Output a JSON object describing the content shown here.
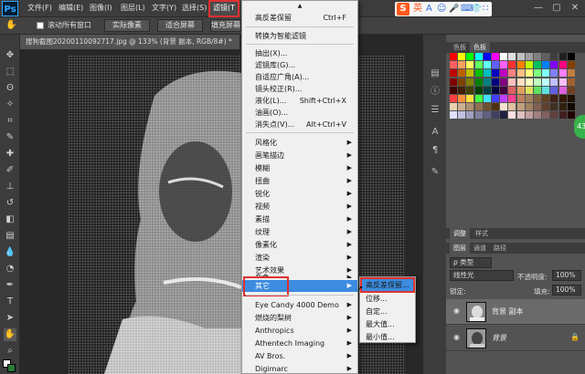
{
  "app": {
    "logo": "Ps"
  },
  "menubar": {
    "items": [
      "文件(F)",
      "编辑(E)",
      "图像(I)",
      "图层(L)",
      "文字(Y)",
      "选择(S)"
    ],
    "active": "滤镜(T"
  },
  "ime_toolbar": {
    "logo": "S",
    "items": [
      "英",
      "A",
      "☺",
      "🎤",
      "⌨",
      "👕",
      "∷"
    ]
  },
  "window_controls": [
    "—",
    "▢",
    "✕"
  ],
  "options_bar": {
    "checkbox_label": "滚动所有窗口",
    "actual_pixels": "实际像素",
    "fit_screen": "适合屏幕",
    "fill_screen": "填充屏幕"
  },
  "document": {
    "tab_title": "搜狗截图20200110092717.jpg @ 133% (背景 副本, RGB/8#) *"
  },
  "filter_menu": {
    "items": [
      {
        "label": "高反差保留",
        "shortcut": "Ctrl+F"
      },
      {
        "label": "转换为智能滤镜"
      },
      {
        "label": "抽出(X)..."
      },
      {
        "label": "滤镜库(G)..."
      },
      {
        "label": "自适应广角(A)..."
      },
      {
        "label": "镜头校正(R)..."
      },
      {
        "label": "液化(L)...",
        "shortcut": "Shift+Ctrl+X"
      },
      {
        "label": "油画(O)..."
      },
      {
        "label": "消失点(V)...",
        "shortcut": "Alt+Ctrl+V"
      },
      {
        "label": "风格化"
      },
      {
        "label": "画笔描边"
      },
      {
        "label": "模糊"
      },
      {
        "label": "扭曲"
      },
      {
        "label": "锐化"
      },
      {
        "label": "视频"
      },
      {
        "label": "素描"
      },
      {
        "label": "纹理"
      },
      {
        "label": "像素化"
      },
      {
        "label": "渲染"
      },
      {
        "label": "艺术效果"
      },
      {
        "label": "杂色"
      },
      {
        "label": "其它"
      },
      {
        "label": "Eye Candy 4000 Demo"
      },
      {
        "label": "燃烧的梨树"
      },
      {
        "label": "Anthropics"
      },
      {
        "label": "Athentech Imaging"
      },
      {
        "label": "AV Bros."
      },
      {
        "label": "Digimarc"
      }
    ],
    "top_arrow": "▲"
  },
  "submenu_other": {
    "items": [
      "高反差保留...",
      "位移...",
      "自定...",
      "最大值...",
      "最小值..."
    ]
  },
  "swatches_panel": {
    "tabs": [
      "色板",
      "色板"
    ]
  },
  "swatch_colors": [
    "#ff0000",
    "#ffff00",
    "#00ff00",
    "#00ffff",
    "#0000ff",
    "#ff00ff",
    "#ffffff",
    "#e0e0e0",
    "#c0c0c0",
    "#a0a0a0",
    "#808080",
    "#606060",
    "#404040",
    "#202020",
    "#000000",
    "#ff6060",
    "#ffa060",
    "#ffff60",
    "#60ff60",
    "#60ffff",
    "#6060ff",
    "#ff60ff",
    "#ff3030",
    "#ff8000",
    "#c0ff00",
    "#00c060",
    "#0080ff",
    "#8000ff",
    "#ff0080",
    "#804000",
    "#c00000",
    "#c06000",
    "#c0c000",
    "#00c000",
    "#00c0c0",
    "#0000c0",
    "#c000c0",
    "#ff8080",
    "#ffc080",
    "#ffff80",
    "#80ff80",
    "#80ffff",
    "#8080ff",
    "#ff80ff",
    "#c08040",
    "#800000",
    "#804000",
    "#808000",
    "#008000",
    "#008080",
    "#000080",
    "#800080",
    "#ffc0c0",
    "#ffe0c0",
    "#ffffc0",
    "#c0ffc0",
    "#c0ffff",
    "#c0c0ff",
    "#ffc0ff",
    "#a06030",
    "#400000",
    "#402000",
    "#404000",
    "#004000",
    "#004040",
    "#000040",
    "#400040",
    "#e06060",
    "#e0a060",
    "#e0e060",
    "#60e060",
    "#60e0e0",
    "#6060e0",
    "#e060e0",
    "#704020",
    "#ff4040",
    "#ff9040",
    "#ffe040",
    "#40ff40",
    "#40e0ff",
    "#4040ff",
    "#c040ff",
    "#ff4090",
    "#c08060",
    "#a08060",
    "#806040",
    "#604020",
    "#402010",
    "#301808",
    "#201000",
    "#e8d0b0",
    "#d0b090",
    "#b09070",
    "#907050",
    "#705030",
    "#503010",
    "#f0e0d0",
    "#e0c0a0",
    "#c0a080",
    "#a08060",
    "#806050",
    "#604030",
    "#403020",
    "#302010",
    "#100800",
    "#e0e0ff",
    "#c0c0e0",
    "#a0a0c0",
    "#8080a0",
    "#606080",
    "#404060",
    "#202040",
    "#ffe0e0",
    "#e0c0c0",
    "#c0a0a0",
    "#a08080",
    "#806060",
    "#604040",
    "#402020",
    "#200000"
  ],
  "adjust_tabs": [
    "调整",
    "样式"
  ],
  "layers_panel": {
    "tabs": [
      "图层",
      "通道",
      "路径"
    ],
    "kind_filter": "ρ 类型",
    "blend_mode": "线性光",
    "opacity_label": "不透明度:",
    "opacity_value": "100%",
    "lock_label": "锁定:",
    "fill_label": "填充:",
    "fill_value": "100%",
    "layers": [
      {
        "name": "背景 副本",
        "selected": true
      },
      {
        "name": "背景",
        "selected": false,
        "locked": true
      }
    ]
  },
  "badge": {
    "text": "43"
  }
}
